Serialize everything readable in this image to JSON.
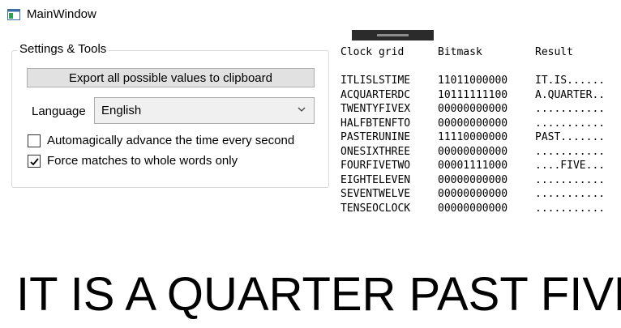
{
  "window": {
    "title": "MainWindow",
    "icon": "window-icon"
  },
  "settings": {
    "group_title": "Settings & Tools",
    "export_button": "Export all possible values to clipboard",
    "language_label": "Language",
    "language_value": "English",
    "auto_advance": {
      "label": "Automagically advance the time every second",
      "checked": false
    },
    "whole_words": {
      "label": "Force matches to whole words only",
      "checked": true
    }
  },
  "grid": {
    "headers": {
      "clock": "Clock grid",
      "bitmask": "Bitmask",
      "result": "Result"
    },
    "rows": [
      {
        "clock": "ITLISLSTIME",
        "bitmask": "11011000000",
        "result": "IT.IS......"
      },
      {
        "clock": "ACQUARTERDC",
        "bitmask": "10111111100",
        "result": "A.QUARTER.."
      },
      {
        "clock": "TWENTYFIVEX",
        "bitmask": "00000000000",
        "result": "..........."
      },
      {
        "clock": "HALFBTENFTO",
        "bitmask": "00000000000",
        "result": "..........."
      },
      {
        "clock": "PASTERUNINE",
        "bitmask": "11110000000",
        "result": "PAST......."
      },
      {
        "clock": "ONESIXTHREE",
        "bitmask": "00000000000",
        "result": "..........."
      },
      {
        "clock": "FOURFIVETWO",
        "bitmask": "00001111000",
        "result": "....FIVE..."
      },
      {
        "clock": "EIGHTELEVEN",
        "bitmask": "00000000000",
        "result": "..........."
      },
      {
        "clock": "SEVENTWELVE",
        "bitmask": "00000000000",
        "result": "..........."
      },
      {
        "clock": "TENSEOCLOCK",
        "bitmask": "00000000000",
        "result": "..........."
      }
    ]
  },
  "time_phrase": "IT IS A QUARTER PAST FIVE"
}
